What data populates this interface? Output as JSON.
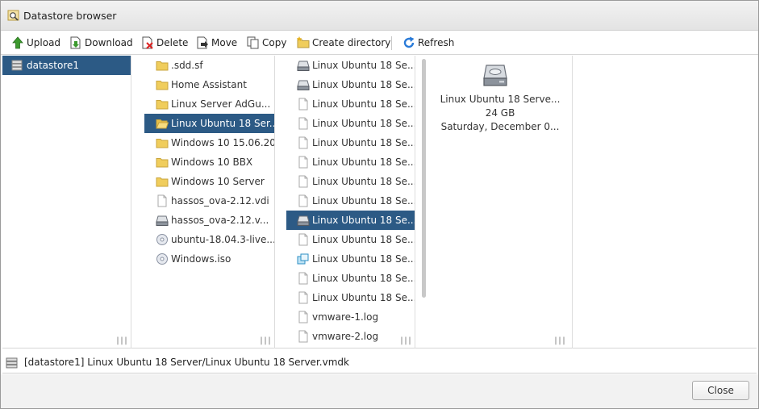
{
  "window": {
    "title": "Datastore browser"
  },
  "toolbar": {
    "upload": "Upload",
    "download": "Download",
    "delete": "Delete",
    "move": "Move",
    "copy": "Copy",
    "create_directory": "Create directory",
    "refresh": "Refresh"
  },
  "datastores": [
    {
      "label": "datastore1",
      "icon": "datastore-icon",
      "selected": true
    }
  ],
  "folder_column": [
    {
      "label": ".sdd.sf",
      "icon": "folder-icon"
    },
    {
      "label": "Home Assistant",
      "icon": "folder-icon"
    },
    {
      "label": "Linux Server AdGu...",
      "icon": "folder-icon"
    },
    {
      "label": "Linux Ubuntu 18 Ser...",
      "icon": "folder-open-icon",
      "selected": true
    },
    {
      "label": "Windows 10 15.06.20",
      "icon": "folder-icon"
    },
    {
      "label": "Windows 10 BBX",
      "icon": "folder-icon"
    },
    {
      "label": "Windows 10 Server",
      "icon": "folder-icon"
    },
    {
      "label": "hassos_ova-2.12.vdi",
      "icon": "file-icon"
    },
    {
      "label": "hassos_ova-2.12.v...",
      "icon": "disk-icon"
    },
    {
      "label": "ubuntu-18.04.3-live...",
      "icon": "iso-icon"
    },
    {
      "label": "Windows.iso",
      "icon": "iso-icon"
    }
  ],
  "file_column": [
    {
      "label": "Linux Ubuntu 18 Se...",
      "icon": "disk-icon"
    },
    {
      "label": "Linux Ubuntu 18 Se...",
      "icon": "disk-icon"
    },
    {
      "label": "Linux Ubuntu 18 Se...",
      "icon": "file-icon"
    },
    {
      "label": "Linux Ubuntu 18 Se...",
      "icon": "file-icon"
    },
    {
      "label": "Linux Ubuntu 18 Se...",
      "icon": "file-icon"
    },
    {
      "label": "Linux Ubuntu 18 Se...",
      "icon": "file-icon"
    },
    {
      "label": "Linux Ubuntu 18 Se...",
      "icon": "file-icon"
    },
    {
      "label": "Linux Ubuntu 18 Se...",
      "icon": "file-icon"
    },
    {
      "label": "Linux Ubuntu 18 Se...",
      "icon": "disk-icon",
      "selected": true
    },
    {
      "label": "Linux Ubuntu 18 Se...",
      "icon": "file-icon"
    },
    {
      "label": "Linux Ubuntu 18 Se...",
      "icon": "vm-icon"
    },
    {
      "label": "Linux Ubuntu 18 Se...",
      "icon": "file-icon"
    },
    {
      "label": "Linux Ubuntu 18 Se...",
      "icon": "file-icon"
    },
    {
      "label": "vmware-1.log",
      "icon": "file-icon"
    },
    {
      "label": "vmware-2.log",
      "icon": "file-icon"
    }
  ],
  "preview": {
    "icon": "hard-disk-icon",
    "name": "Linux Ubuntu 18 Serve...",
    "size": "24 GB",
    "date": "Saturday, December 0..."
  },
  "status": {
    "path": "[datastore1] Linux Ubuntu 18 Server/Linux Ubuntu 18 Server.vmdk"
  },
  "footer": {
    "close": "Close"
  },
  "colors": {
    "selection": "#2c5a85",
    "folder": "#f0cd5c",
    "refresh": "#2a7bd8",
    "upload": "#3c9a2e"
  }
}
